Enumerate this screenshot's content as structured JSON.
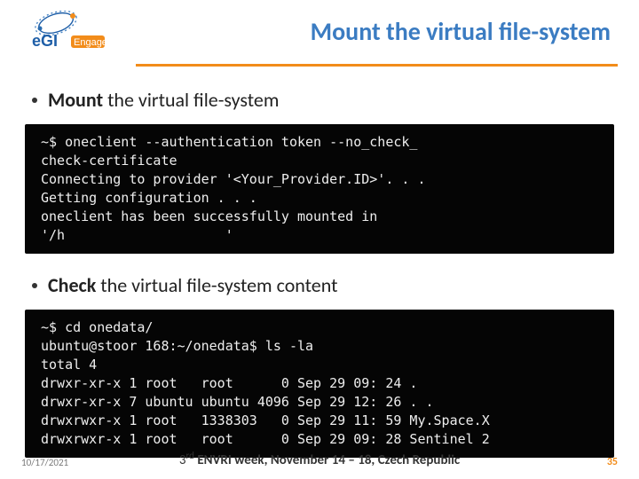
{
  "logo": {
    "brand": "eGI",
    "tagline": "Engage"
  },
  "header": {
    "title": "Mount the virtual file-system"
  },
  "bullets": {
    "mount": {
      "bold": "Mount",
      "rest": " the virtual file-system"
    },
    "check": {
      "bold": "Check",
      "rest": " the virtual file-system content"
    }
  },
  "terminal1": {
    "line1": "~$ oneclient --authentication token --no_check_",
    "line2": "check-certificate",
    "line3": "Connecting to provider '<Your_Provider.ID>'. . .",
    "line4": "Getting configuration . . .",
    "line5": "oneclient has been successfully mounted in",
    "line6": "'/h                    '"
  },
  "terminal2": {
    "line1": "~$ cd onedata/",
    "line2": "ubuntu@stoor 168:~/onedata$ ls -la",
    "line3": "total 4",
    "line4": "drwxr-xr-x 1 root   root      0 Sep 29 09: 24 .",
    "line5": "drwxr-xr-x 7 ubuntu ubuntu 4096 Sep 29 12: 26 . .",
    "line6": "drwxrwxr-x 1 root   1338303   0 Sep 29 11: 59 My.Space.X",
    "line7": "drwxrwxr-x 1 root   root      0 Sep 29 09: 28 Sentinel 2"
  },
  "footer": {
    "date": "10/17/2021",
    "center_pre": "3",
    "center_ord": "rd",
    "center_rest": " ENVRI week,  November 14 – 18, Czech Republic",
    "page": "35"
  }
}
